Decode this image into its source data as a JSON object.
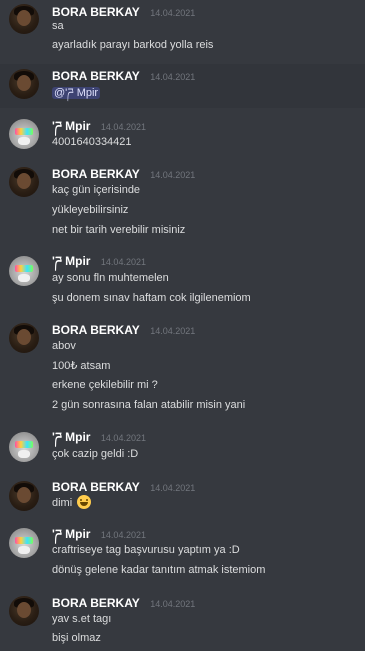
{
  "messages": [
    {
      "author": "BORA BERKAY",
      "timestamp": "14.04.2021",
      "avatar": "bora-avatar",
      "lines": [
        "sa",
        "ayarladık parayı barkod yolla reis"
      ]
    },
    {
      "author": "BORA BERKAY",
      "timestamp": "14.04.2021",
      "avatar": "bora-avatar",
      "lines": [
        "@'ཌ Mpir"
      ]
    },
    {
      "author": "'ཌ Mpir",
      "timestamp": "14.04.2021",
      "avatar": "mpir-avatar",
      "lines": [
        "4001640334421"
      ]
    },
    {
      "author": "BORA BERKAY",
      "timestamp": "14.04.2021",
      "avatar": "bora-avatar",
      "lines": [
        "kaç gün içerisinde",
        "yükleyebilirsiniz",
        "net bir tarih verebilir misiniz"
      ]
    },
    {
      "author": "'ཌ Mpir",
      "timestamp": "14.04.2021",
      "avatar": "mpir-avatar",
      "lines": [
        "ay sonu fln muhtemelen",
        "şu donem sınav haftam cok ilgilenemiom"
      ]
    },
    {
      "author": "BORA BERKAY",
      "timestamp": "14.04.2021",
      "avatar": "bora-avatar",
      "lines": [
        "abov",
        "100₺ atsam",
        "erkene çekilebilir mi ?",
        "2 gün sonrasına falan atabilir misin yani"
      ]
    },
    {
      "author": "'ཌ Mpir",
      "timestamp": "14.04.2021",
      "avatar": "mpir-avatar",
      "lines": [
        "çok cazip geldi :D"
      ]
    },
    {
      "author": "BORA BERKAY",
      "timestamp": "14.04.2021",
      "avatar": "bora-avatar",
      "lines": [
        "dimi"
      ],
      "emoji": "grinning-face-emoji"
    },
    {
      "author": "'ཌ Mpir",
      "timestamp": "14.04.2021",
      "avatar": "mpir-avatar",
      "lines": [
        "craftriseye tag başvurusu yaptım ya :D",
        "dönüş gelene kadar tanıtım atmak istemiom"
      ]
    },
    {
      "author": "BORA BERKAY",
      "timestamp": "14.04.2021",
      "avatar": "bora-avatar",
      "lines": [
        "yav s.et tagı",
        "bişi olmaz"
      ]
    }
  ],
  "colors": {
    "background": "#36393f",
    "highlight": "#32353b",
    "username": "#ffffff",
    "timestamp": "#72767d",
    "text": "#dcddde",
    "mention_bg": "#5865f24d"
  }
}
